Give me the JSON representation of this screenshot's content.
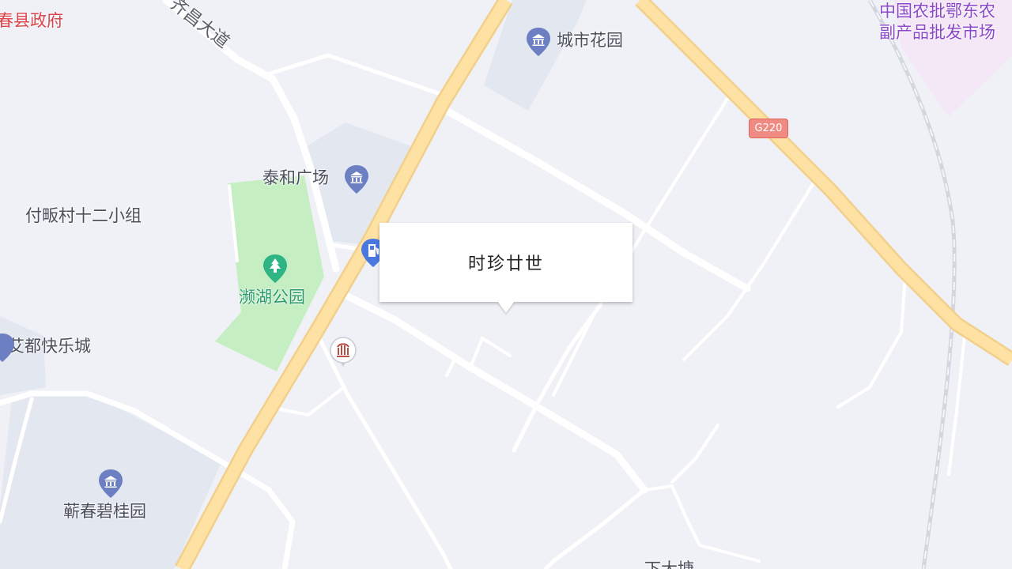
{
  "popup": {
    "title": "时珍廿世"
  },
  "labels": {
    "county_gov": "春县政府",
    "qichang_road": "齐昌大道",
    "city_garden": "城市花园",
    "market": "中国农批鄂东农",
    "market_line2": "副产品批发市场",
    "taihe_plaza": "泰和广场",
    "fuban_village": "付畈村十二小组",
    "binhu_park": "濒湖公园",
    "aidu": "艾都快乐城",
    "qichun_bigui": "蕲春碧桂园",
    "bottom_partial": "下大塘"
  },
  "road_shield": {
    "text": "G220"
  },
  "colors": {
    "background": "#eff1f7",
    "highway": "#fde2a4",
    "road": "#ffffff",
    "park": "#c5eec3",
    "poi_icon": "#6b7fc2",
    "park_icon": "#2fb483",
    "market_zone": "#f5e8f7"
  }
}
